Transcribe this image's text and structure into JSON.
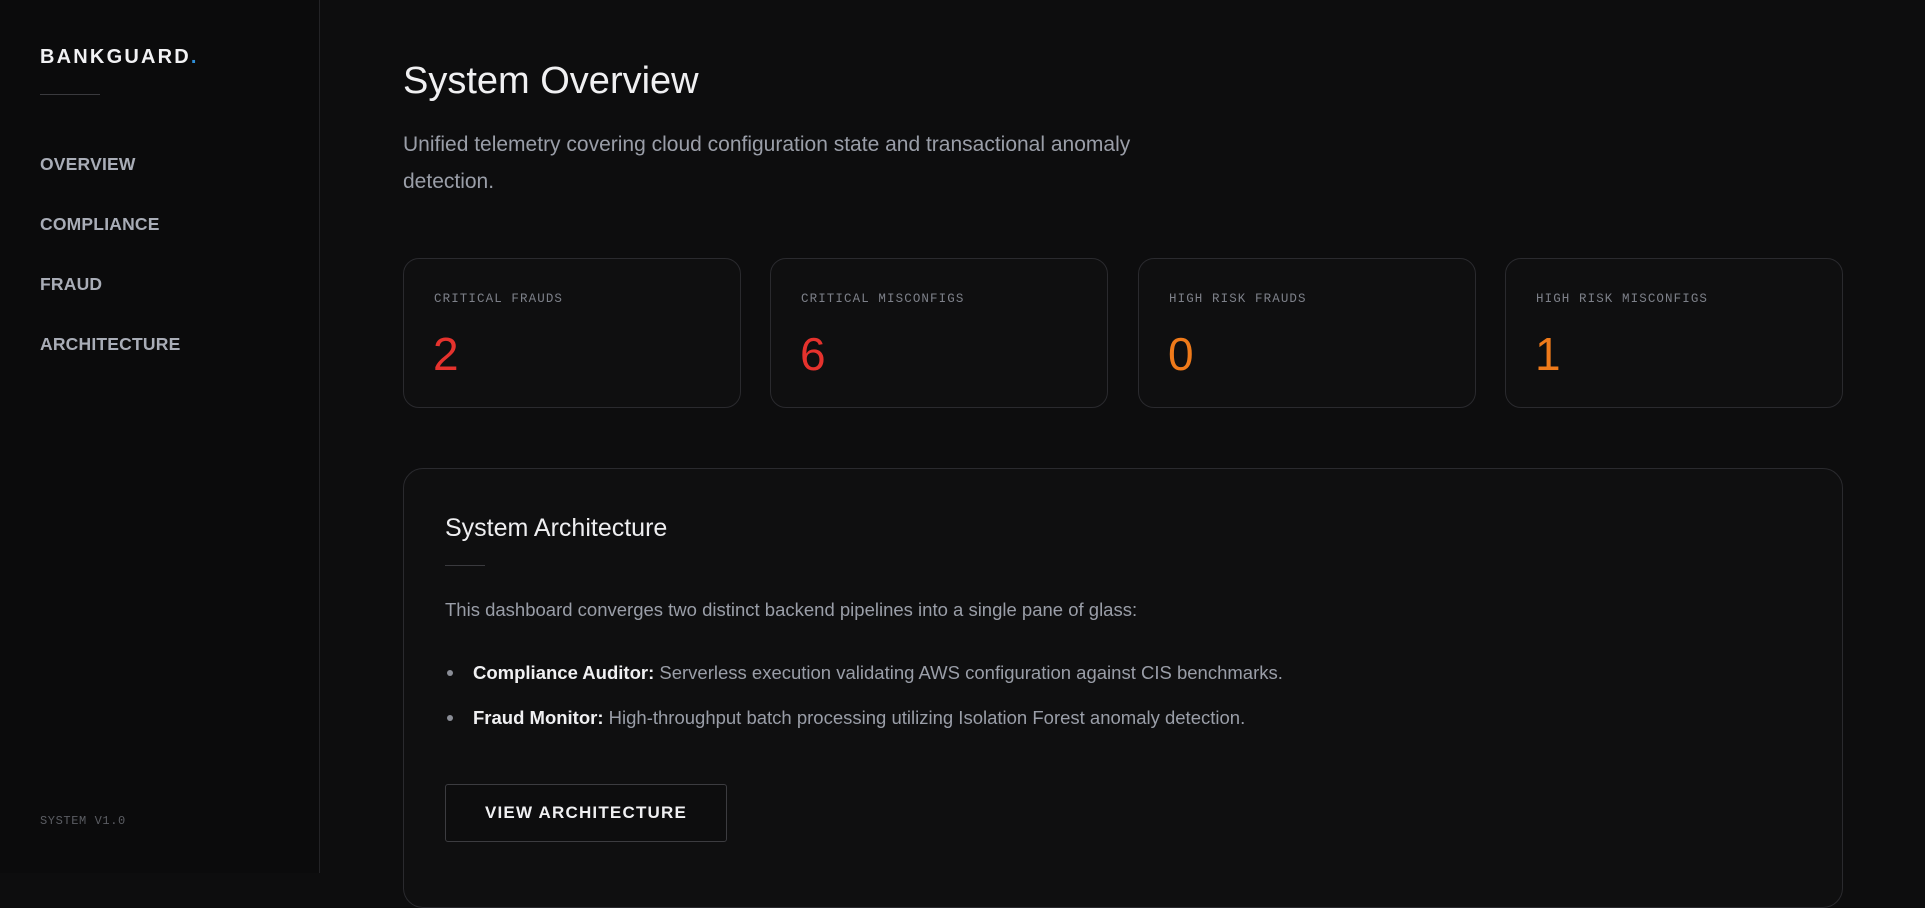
{
  "sidebar": {
    "logo_text": "BANKGUARD",
    "logo_dot": ".",
    "nav": [
      {
        "label": "OVERVIEW"
      },
      {
        "label": "COMPLIANCE"
      },
      {
        "label": "FRAUD"
      },
      {
        "label": "ARCHITECTURE"
      }
    ],
    "version": "SYSTEM V1.0"
  },
  "header": {
    "title": "System Overview",
    "subtitle": "Unified telemetry covering cloud configuration state and transactional anomaly detection."
  },
  "stats": [
    {
      "label": "CRITICAL FRAUDS",
      "value": "2",
      "color": "#e5322d"
    },
    {
      "label": "CRITICAL MISCONFIGS",
      "value": "6",
      "color": "#e5322d"
    },
    {
      "label": "HIGH RISK FRAUDS",
      "value": "0",
      "color": "#ef7a1a"
    },
    {
      "label": "HIGH RISK MISCONFIGS",
      "value": "1",
      "color": "#ef7a1a"
    }
  ],
  "architecture": {
    "title": "System Architecture",
    "intro": "This dashboard converges two distinct backend pipelines into a single pane of glass:",
    "items": [
      {
        "name": "Compliance Auditor:",
        "description": " Serverless execution validating AWS configuration against CIS benchmarks."
      },
      {
        "name": "Fraud Monitor:",
        "description": " High-throughput batch processing utilizing Isolation Forest anomaly detection."
      }
    ],
    "button_label": "VIEW ARCHITECTURE"
  },
  "colors": {
    "background": "#0d0d0e",
    "accent": "#2f8fd8",
    "critical": "#e5322d",
    "high": "#ef7a1a"
  }
}
